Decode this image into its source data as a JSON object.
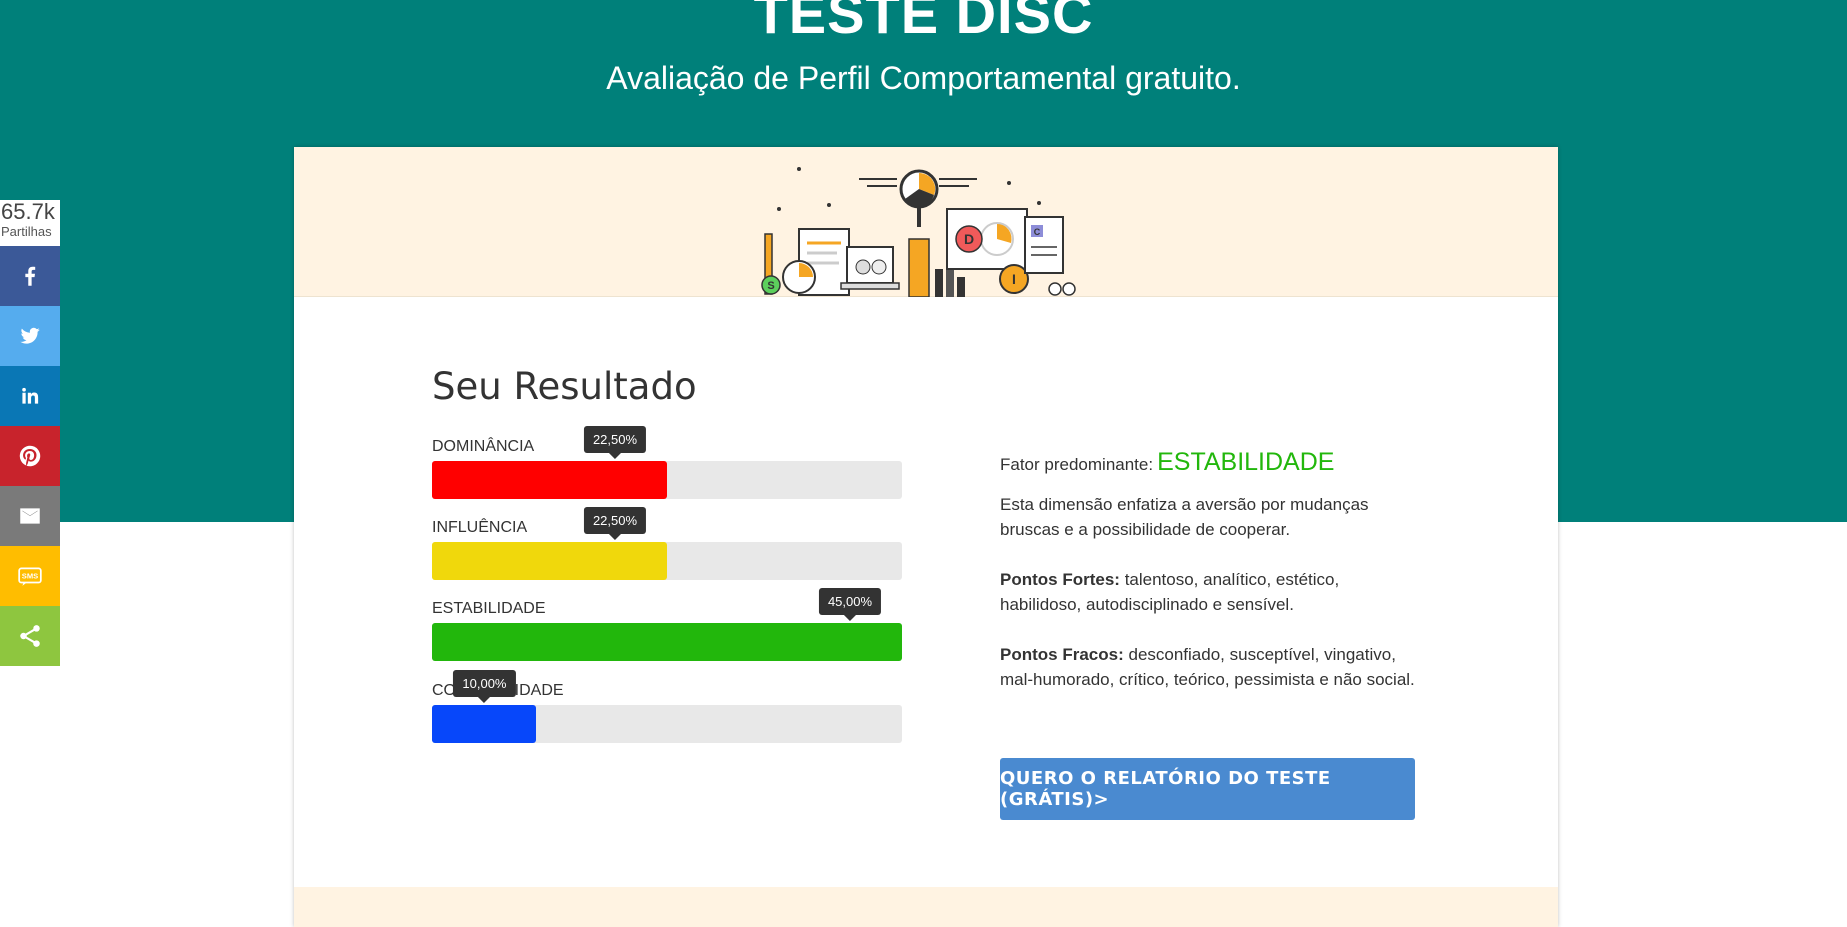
{
  "header": {
    "title": "TESTE DISC",
    "subtitle": "Avaliação de Perfil Comportamental gratuito."
  },
  "share": {
    "count": "65.7k",
    "count_label": "Partilhas",
    "buttons": [
      "facebook-icon",
      "twitter-icon",
      "linkedin-icon",
      "pinterest-icon",
      "email-icon",
      "sms-icon",
      "share-icon"
    ],
    "sms_text": "SMS",
    "colors": {
      "facebook": "#3b5998",
      "twitter": "#55acee",
      "linkedin": "#0a77b5",
      "pinterest": "#c8232c",
      "email": "#7a7a7a",
      "sms": "#ffbd00",
      "share": "#8ec63f"
    }
  },
  "result": {
    "title": "Seu Resultado",
    "bars": [
      {
        "label": "DOMINÂNCIA",
        "value": 22.5,
        "display": "22,50%",
        "color": "#ff0000"
      },
      {
        "label": "INFLUÊNCIA",
        "value": 22.5,
        "display": "22,50%",
        "color": "#f0d80c"
      },
      {
        "label": "ESTABILIDADE",
        "value": 45.0,
        "display": "45,00%",
        "color": "#22b70c"
      },
      {
        "label": "CONFORMIDADE",
        "value": 10.0,
        "display": "10,00%",
        "color": "#0747fa"
      }
    ],
    "bar_max": 45.0
  },
  "profile": {
    "predominant_label": "Fator predominante:",
    "predominant_value": "ESTABILIDADE",
    "description": "Esta dimensão enfatiza a aversão por mudanças bruscas e a possibilidade de cooperar.",
    "strengths_label": "Pontos Fortes:",
    "strengths_text": "talentoso, analítico, estético, habilidoso, autodisciplinado e sensível.",
    "weaknesses_label": "Pontos Fracos:",
    "weaknesses_text": "desconfiado, susceptível, vingativo, mal-humorado, crítico, teórico, pessimista e não social."
  },
  "cta": {
    "label": "QUERO O RELATÓRIO DO TESTE (GRÁTIS)>"
  },
  "illustration": {
    "letters": [
      "D",
      "I",
      "S",
      "C"
    ]
  }
}
